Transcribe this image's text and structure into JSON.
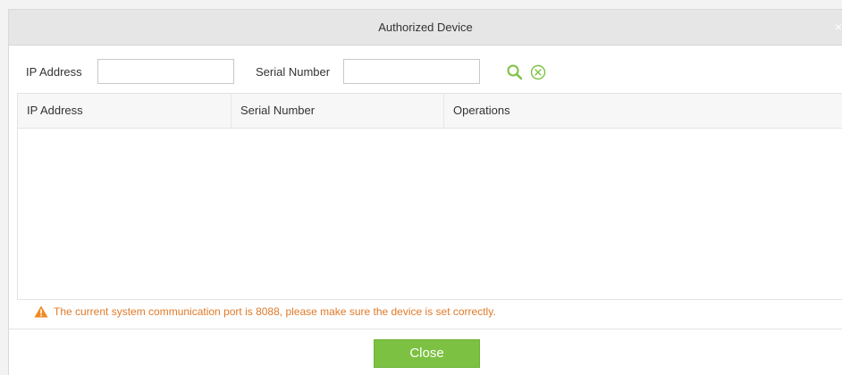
{
  "dialog": {
    "title": "Authorized Device",
    "close_glyph": "×"
  },
  "filters": {
    "ip_label": "IP Address",
    "ip_value": "",
    "serial_label": "Serial Number",
    "serial_value": "",
    "search_icon": "search-icon",
    "clear_icon": "clear-circle-icon"
  },
  "grid": {
    "columns": [
      "IP Address",
      "Serial Number",
      "Operations"
    ],
    "rows": []
  },
  "warning": {
    "icon": "warning-triangle-icon",
    "text": "The current system communication port is 8088, please make sure the device is set correctly."
  },
  "footer": {
    "close_label": "Close"
  },
  "colors": {
    "accent_green": "#7cc142",
    "warning_orange": "#e07a2a"
  }
}
